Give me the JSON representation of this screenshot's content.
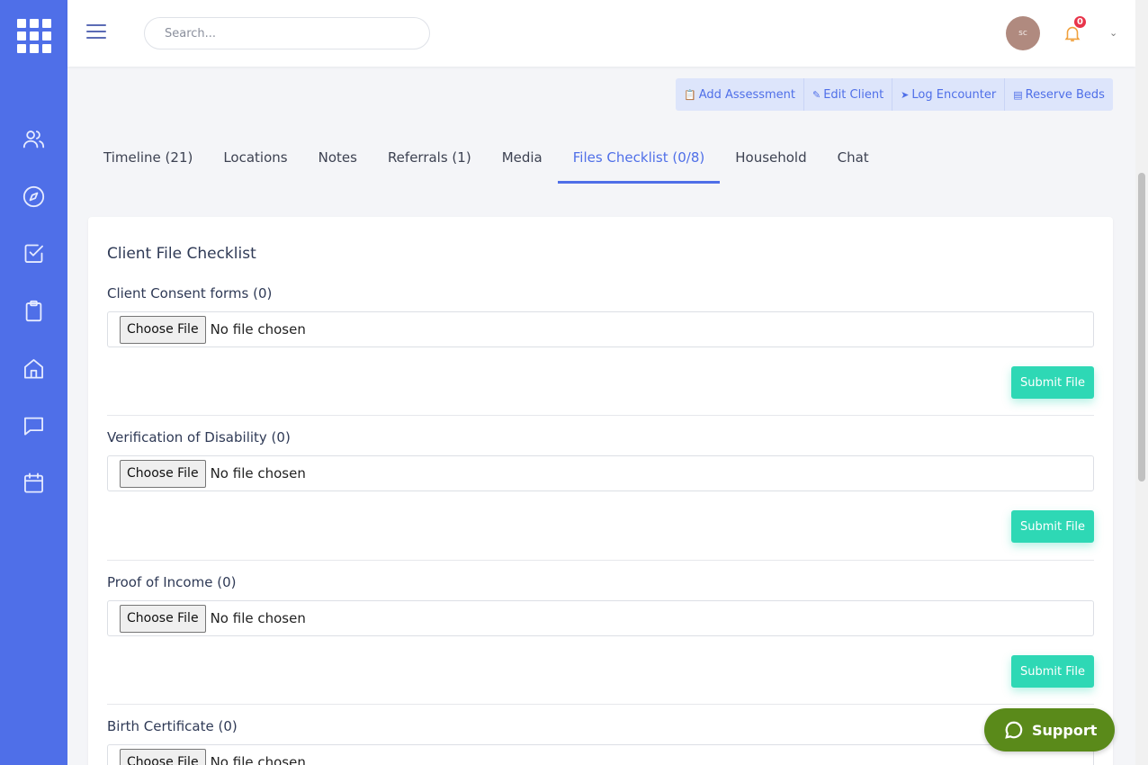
{
  "header": {
    "search_placeholder": "Search...",
    "avatar_initials": "sc",
    "notifications_count": "0"
  },
  "actions": [
    {
      "label": "Add Assessment",
      "icon": "clipboard-icon"
    },
    {
      "label": "Edit Client",
      "icon": "edit-icon"
    },
    {
      "label": "Log Encounter",
      "icon": "location-arrow-icon"
    },
    {
      "label": "Reserve Beds",
      "icon": "archive-icon"
    }
  ],
  "tabs": [
    {
      "label": "Timeline (21)"
    },
    {
      "label": "Locations"
    },
    {
      "label": "Notes"
    },
    {
      "label": "Referrals (1)"
    },
    {
      "label": "Media"
    },
    {
      "label": "Files Checklist (0/8)",
      "active": true
    },
    {
      "label": "Household"
    },
    {
      "label": "Chat"
    }
  ],
  "card": {
    "title": "Client File Checklist",
    "sections": [
      {
        "title": "Client Consent forms (0)",
        "choose_label": "Choose File",
        "file_status": "No file chosen",
        "submit_label": "Submit File"
      },
      {
        "title": "Verification of Disability (0)",
        "choose_label": "Choose File",
        "file_status": "No file chosen",
        "submit_label": "Submit File"
      },
      {
        "title": "Proof of Income (0)",
        "choose_label": "Choose File",
        "file_status": "No file chosen",
        "submit_label": "Submit File"
      },
      {
        "title": "Birth Certificate (0)",
        "choose_label": "Choose File",
        "file_status": "No file chosen"
      }
    ]
  },
  "support": {
    "label": "Support"
  },
  "colors": {
    "sidebar": "#4f6fe8",
    "accent": "#4f6fe8",
    "submit": "#2ed8b5",
    "support": "#5a8a1a",
    "badge": "#e8344a"
  }
}
